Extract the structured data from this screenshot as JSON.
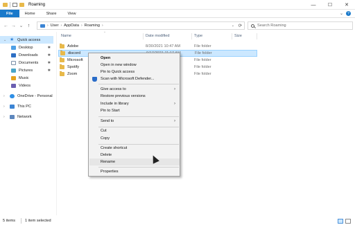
{
  "window": {
    "title": "Roaming",
    "controls": [
      "—",
      "☐",
      "✕"
    ]
  },
  "ribbon": {
    "tabs": [
      "File",
      "Home",
      "Share",
      "View"
    ],
    "right_chevron": "⌄",
    "help": "?"
  },
  "nav_buttons": {
    "back": "←",
    "forward": "→",
    "recent": "⌄",
    "up": "↑"
  },
  "address": {
    "segments": [
      "User",
      "AppData",
      "Roaming"
    ],
    "separator": "›",
    "dropdown": "⌄",
    "refresh": "⟳"
  },
  "search": {
    "placeholder": "Search Roaming"
  },
  "navpane": {
    "items": [
      {
        "label": "Quick access",
        "icon": "star-icon",
        "selected": true
      },
      {
        "label": "Desktop",
        "icon": "desktop-icon",
        "pinned": true
      },
      {
        "label": "Downloads",
        "icon": "download-icon",
        "pinned": true
      },
      {
        "label": "Documents",
        "icon": "document-icon",
        "pinned": true
      },
      {
        "label": "Pictures",
        "icon": "pictures-icon",
        "pinned": true
      },
      {
        "label": "Music",
        "icon": "music-icon"
      },
      {
        "label": "Videos",
        "icon": "videos-icon"
      },
      {
        "label": "OneDrive - Personal",
        "icon": "onedrive-icon"
      },
      {
        "label": "This PC",
        "icon": "pc-icon"
      },
      {
        "label": "Network",
        "icon": "network-icon"
      }
    ],
    "pin_glyph": "📌"
  },
  "columns": {
    "name": "Name",
    "date": "Date modified",
    "type": "Type",
    "size": "Size",
    "sort_caret": "^"
  },
  "files": [
    {
      "name": "Adobe",
      "date": "8/30/2021 10:47 AM",
      "type": "File folder",
      "selected": false
    },
    {
      "name": "discord",
      "date": "9/17/2021 11:17 AM",
      "type": "File folder",
      "selected": true
    },
    {
      "name": "Microsoft",
      "date": "",
      "type": "File folder",
      "selected": false
    },
    {
      "name": "Spotify",
      "date": "",
      "type": "File folder",
      "selected": false
    },
    {
      "name": "Zoom",
      "date": "",
      "type": "File folder",
      "selected": false
    }
  ],
  "context_menu": {
    "items": [
      {
        "label": "Open",
        "bold": true
      },
      {
        "label": "Open in new window"
      },
      {
        "label": "Pin to Quick access"
      },
      {
        "label": "Scan with Microsoft Defender...",
        "icon": "defender-shield-icon"
      },
      {
        "sep": true
      },
      {
        "label": "Give access to",
        "submenu": true
      },
      {
        "label": "Restore previous versions"
      },
      {
        "label": "Include in library",
        "submenu": true
      },
      {
        "label": "Pin to Start"
      },
      {
        "sep": true
      },
      {
        "label": "Send to",
        "submenu": true
      },
      {
        "sep": true
      },
      {
        "label": "Cut"
      },
      {
        "label": "Copy"
      },
      {
        "sep": true
      },
      {
        "label": "Create shortcut"
      },
      {
        "label": "Delete"
      },
      {
        "label": "Rename",
        "hover": true
      },
      {
        "sep": true
      },
      {
        "label": "Properties"
      }
    ],
    "submenu_arrow": "›"
  },
  "status": {
    "count": "5 items",
    "selection": "1 item selected"
  }
}
